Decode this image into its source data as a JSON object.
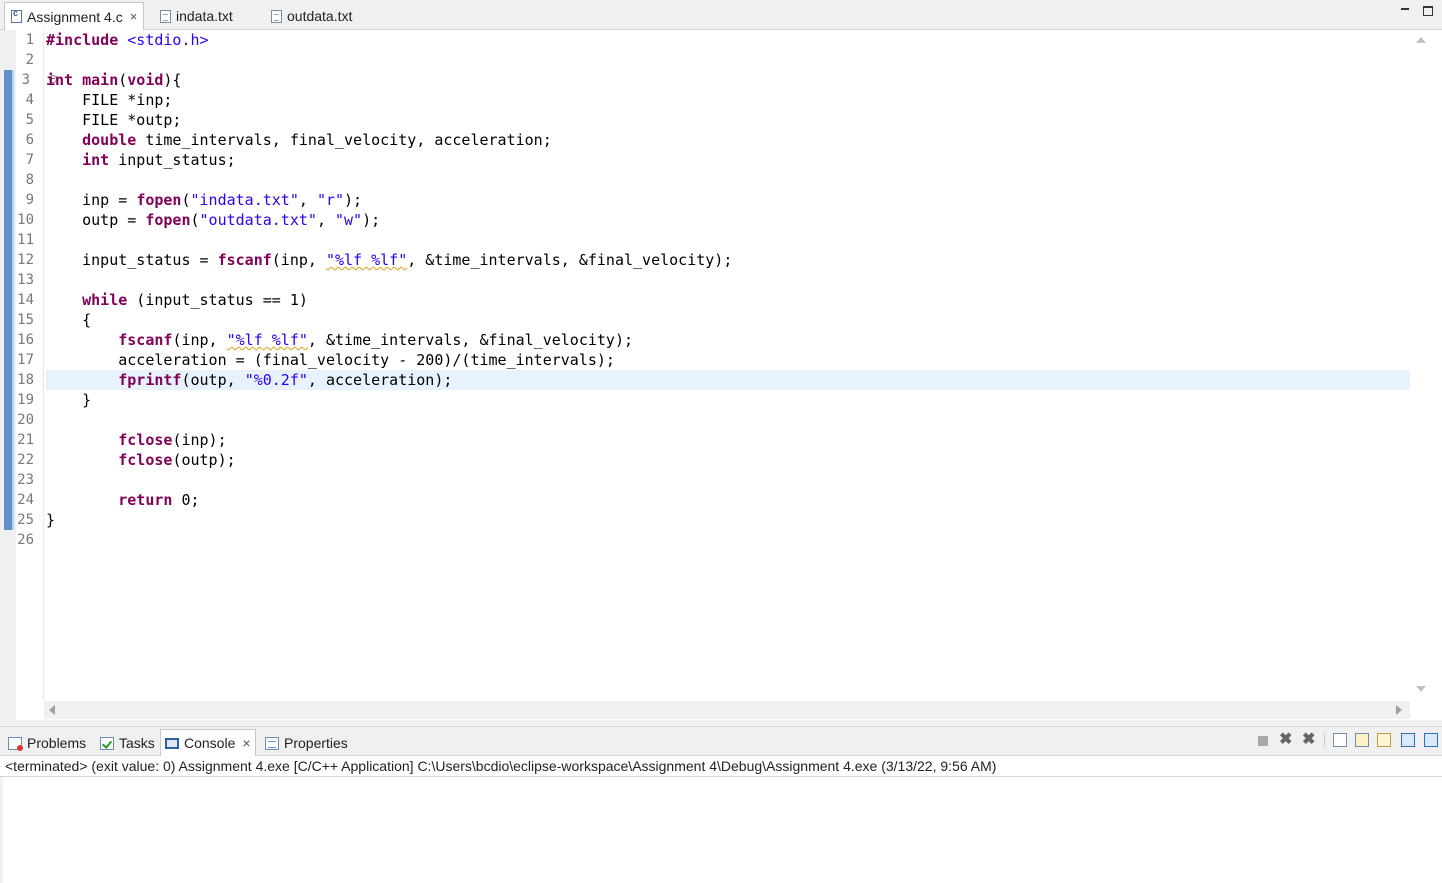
{
  "editor_tabs": [
    {
      "label": "Assignment 4.c",
      "icon": "c-file-icon",
      "active": true,
      "closable": true
    },
    {
      "label": "indata.txt",
      "icon": "text-file-icon",
      "active": false,
      "closable": false
    },
    {
      "label": "outdata.txt",
      "icon": "text-file-icon",
      "active": false,
      "closable": false
    }
  ],
  "close_glyph": "×",
  "line_numbers": [
    "1",
    "2",
    "3",
    "4",
    "5",
    "6",
    "7",
    "8",
    "9",
    "10",
    "11",
    "12",
    "13",
    "14",
    "15",
    "16",
    "17",
    "18",
    "19",
    "20",
    "21",
    "22",
    "23",
    "24",
    "25",
    "26"
  ],
  "code": {
    "l1_pp": "#include",
    "l1_inc": "<stdio.h>",
    "l3_kw1": "int",
    "l3_name": "main",
    "l3_paren": "(",
    "l3_kw2": "void",
    "l3_rest": "){",
    "l4": "    FILE *inp;",
    "l5": "    FILE *outp;",
    "l6_kw": "double",
    "l6_rest": " time_intervals, final_velocity, acceleration;",
    "l7_kw": "int",
    "l7_rest": " input_status;",
    "l9_a": "    inp = ",
    "l9_fn": "fopen",
    "l9_b": "(",
    "l9_s1": "\"indata.txt\"",
    "l9_c": ", ",
    "l9_s2": "\"r\"",
    "l9_d": ");",
    "l10_a": "    outp = ",
    "l10_fn": "fopen",
    "l10_b": "(",
    "l10_s1": "\"outdata.txt\"",
    "l10_c": ", ",
    "l10_s2": "\"w\"",
    "l10_d": ");",
    "l12_a": "    input_status = ",
    "l12_fn": "fscanf",
    "l12_b": "(inp, ",
    "l12_s": "\"%lf %lf\"",
    "l12_c": ", &time_intervals, &final_velocity);",
    "l14_kw": "while",
    "l14_rest": " (input_status == 1)",
    "l15": "    {",
    "l16_fn": "fscanf",
    "l16_b": "(inp, ",
    "l16_s": "\"%lf %lf\"",
    "l16_c": ", &time_intervals, &final_velocity);",
    "l17": "        acceleration = (final_velocity - 200)/(time_intervals);",
    "l18_fn": "fprintf",
    "l18_b": "(outp, ",
    "l18_s": "\"%0.2f\"",
    "l18_c": ", acceleration);",
    "l19": "    }",
    "l21_fn": "fclose",
    "l21_rest": "(inp);",
    "l22_fn": "fclose",
    "l22_rest": "(outp);",
    "l24_kw": "return",
    "l24_rest": " 0;",
    "l25": "}"
  },
  "panel_tabs": [
    {
      "label": "Problems",
      "icon": "problems-icon",
      "active": false
    },
    {
      "label": "Tasks",
      "icon": "tasks-icon",
      "active": false
    },
    {
      "label": "Console",
      "icon": "console-icon",
      "active": true,
      "closable": true
    },
    {
      "label": "Properties",
      "icon": "properties-icon",
      "active": false
    }
  ],
  "console": {
    "status_line": "<terminated> (exit value: 0) Assignment 4.exe [C/C++ Application] C:\\Users\\bcdio\\eclipse-workspace\\Assignment 4\\Debug\\Assignment 4.exe (3/13/22, 9:56 AM)"
  },
  "colors": {
    "keyword": "#7f0055",
    "string": "#2a00ff",
    "current_line": "#e8f2fe",
    "change_bar": "#5b93c9"
  }
}
